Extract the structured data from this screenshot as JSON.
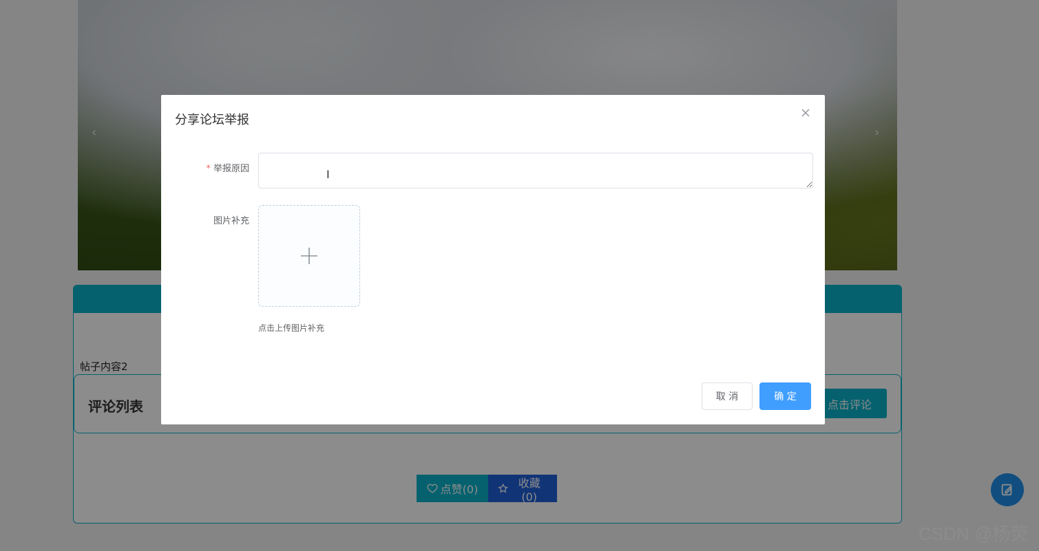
{
  "background": {
    "post_content": "帖子内容2",
    "comment_section_title": "评论列表",
    "comment_button_label": "点击评论",
    "like_button_label": "点赞(0)",
    "favorite_button_label": "收藏(0)",
    "watermark": "CSDN @杨荧"
  },
  "dialog": {
    "title": "分享论坛举报",
    "reason_label": "举报原因",
    "reason_required_mark": "*",
    "reason_value": "",
    "image_label": "图片补充",
    "upload_hint": "点击上传图片补充",
    "cancel_label": "取 消",
    "confirm_label": "确 定"
  },
  "colors": {
    "accent": "#0ab1c8",
    "primary": "#409eff",
    "favorite": "#1f5fd8"
  }
}
